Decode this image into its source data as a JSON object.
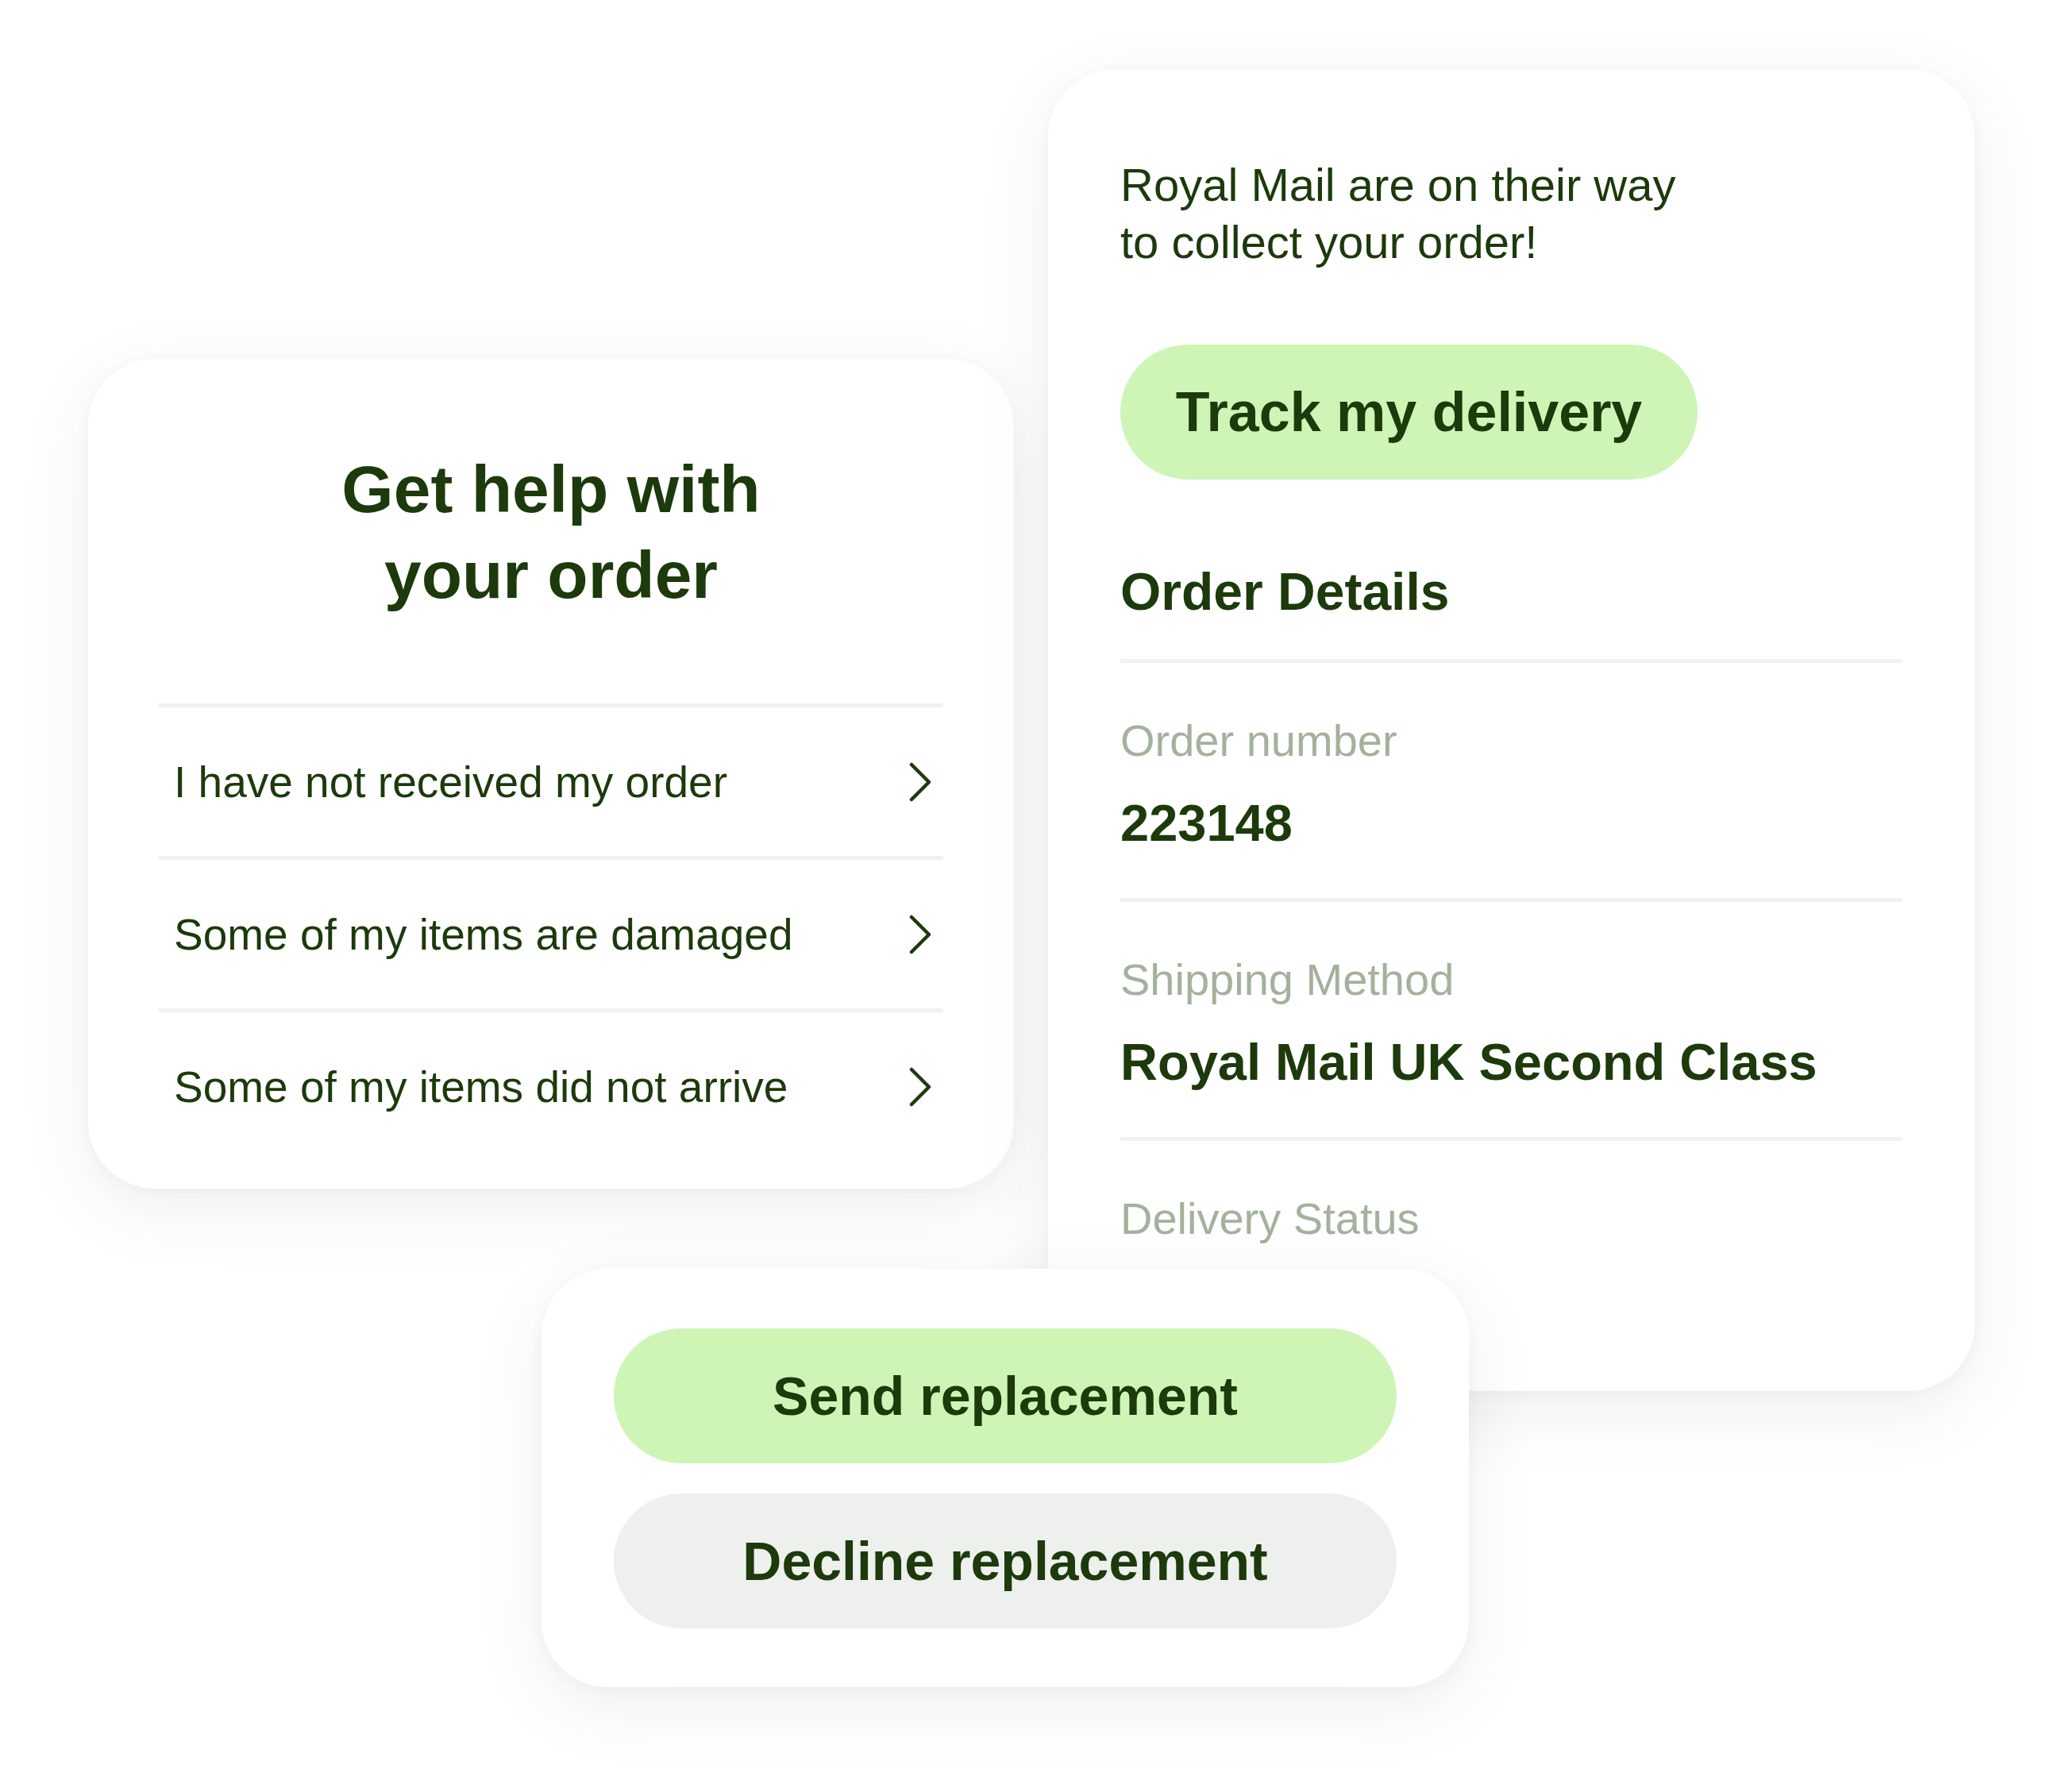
{
  "help_card": {
    "title": "Get help with\nyour order",
    "options": [
      {
        "label": "I have not received my order"
      },
      {
        "label": "Some of my items are damaged"
      },
      {
        "label": "Some of my items did not arrive"
      }
    ]
  },
  "order_card": {
    "message": "Royal Mail are on their way\nto collect your order!",
    "track_button": "Track my delivery",
    "section_title": "Order Details",
    "fields": [
      {
        "label": "Order number",
        "value": "223148"
      },
      {
        "label": "Shipping Method",
        "value": "Royal Mail UK Second Class"
      },
      {
        "label": "Delivery Status"
      }
    ]
  },
  "replacement_card": {
    "buttons": [
      {
        "label": "Send replacement",
        "kind": "primary"
      },
      {
        "label": "Decline replacement",
        "kind": "secondary"
      }
    ]
  }
}
